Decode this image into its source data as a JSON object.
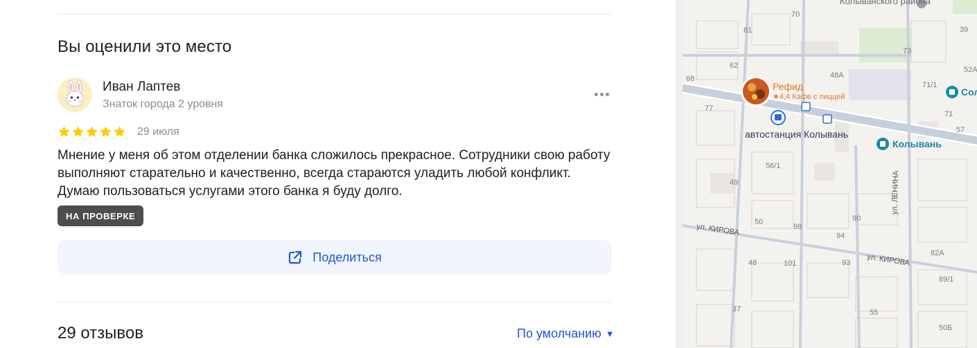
{
  "my_review": {
    "section_title": "Вы оценили это место",
    "author": {
      "name": "Иван Лаптев",
      "level": "Знаток города 2 уровня",
      "avatar_icon": "bunny-icon"
    },
    "rating": 5,
    "date": "29 июля",
    "text": "Мнение у меня об этом отделении банка сложилось прекрасное. Сотрудники свою работу выполняют старательно и качественно, всегда стараются уладить любой конфликт. Думаю пользоваться услугами этого банка я буду долго.",
    "status_badge": "НА ПРОВЕРКЕ",
    "share_label": "Поделиться"
  },
  "reviews": {
    "count_label": "29 отзывов",
    "sort_label": "По умолчанию",
    "sort_arrow": "▼"
  },
  "map": {
    "district": "Колыванского района",
    "poi": {
      "name": "Рефид",
      "subtitle": "★4,4 Кафе с пиццей"
    },
    "bus_stop": "автостанция Колывань",
    "shop": "Колывань",
    "shop_right": "Сол",
    "streets": {
      "kirova_left": "ул. КИРОВА",
      "kirova_right": "ул. КИРОВА",
      "lenina": "ул. ЛЕНИНА"
    },
    "house_numbers": [
      "70",
      "39",
      "61",
      "62",
      "73",
      "52А",
      "68",
      "48А",
      "71/1",
      "77",
      "71",
      "57",
      "56/1",
      "49",
      "50",
      "98",
      "94",
      "90",
      "101",
      "93",
      "82А",
      "48",
      "89/1",
      "37",
      "55",
      "50Б"
    ]
  },
  "colors": {
    "accent": "#2156d6",
    "star": "#fc0",
    "badge": "#4d4d4d",
    "poi": "#e4782a"
  }
}
